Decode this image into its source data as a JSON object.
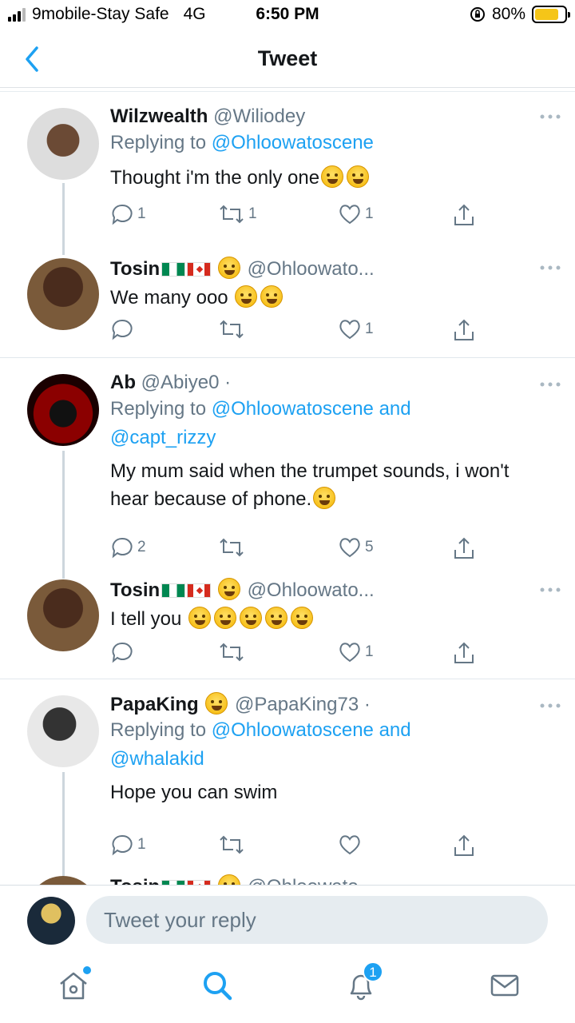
{
  "status_bar": {
    "carrier": "9mobile-Stay Safe",
    "network": "4G",
    "time": "6:50 PM",
    "battery": "80%",
    "battery_level": 0.8
  },
  "header": {
    "title": "Tweet"
  },
  "tweets": [
    {
      "name": "Wilzwealth",
      "handle": "@Wiliodey",
      "replying_to_prefix": "Replying to ",
      "replying_to": "@Ohloowatoscene",
      "replying_to_extra": "",
      "text": "Thought i'm the only one",
      "emoji_count": 2,
      "reply_count": "1",
      "retweet_count": "1",
      "like_count": "1"
    },
    {
      "name": "Tosin",
      "handle": "@Ohloowato...",
      "text": "We many ooo",
      "emoji_count": 2,
      "reply_count": "",
      "retweet_count": "",
      "like_count": "1"
    },
    {
      "name": "Ab",
      "handle": "@Abiye0 ·",
      "replying_to_prefix": "Replying to ",
      "replying_to": "@Ohloowatoscene and",
      "replying_to_extra": "@capt_rizzy",
      "text": "My mum said when the trumpet sounds, i won't hear because of phone.",
      "emoji_count": 1,
      "reply_count": "2",
      "retweet_count": "",
      "like_count": "5"
    },
    {
      "name": "Tosin",
      "handle": "@Ohloowato...",
      "text": "I tell you",
      "emoji_count": 5,
      "reply_count": "",
      "retweet_count": "",
      "like_count": "1"
    },
    {
      "name": "PapaKing",
      "handle": "@PapaKing73 ·",
      "replying_to_prefix": "Replying to ",
      "replying_to": "@Ohloowatoscene and",
      "replying_to_extra": "@whalakid",
      "text": "Hope you can swim",
      "emoji_count": 0,
      "reply_count": "1",
      "retweet_count": "",
      "like_count": ""
    },
    {
      "name": "Tosin",
      "handle": "@Ohloowato"
    }
  ],
  "composer": {
    "placeholder": "Tweet your reply"
  },
  "tab_bar": {
    "notification_count": "1",
    "accent": "#1da1f2"
  },
  "colors": {
    "accent": "#1da1f2",
    "secondary_text": "#657786",
    "primary_text": "#14171a",
    "divider": "#e1e8ed"
  }
}
